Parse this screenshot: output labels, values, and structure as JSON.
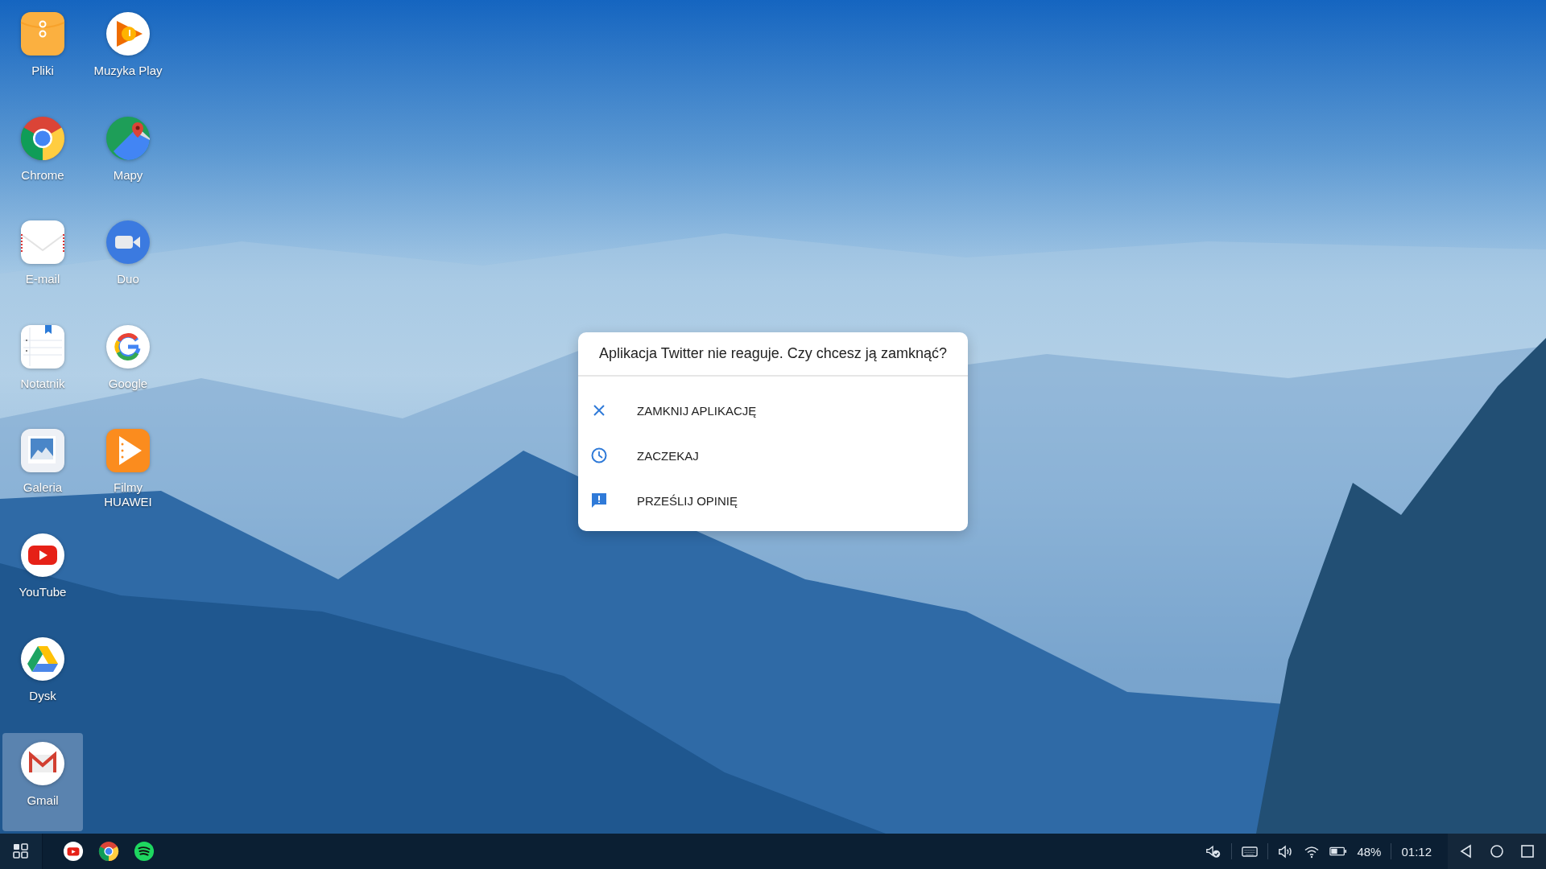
{
  "desktop_icons": [
    {
      "label": "Pliki",
      "kind": "files",
      "selected": false
    },
    {
      "label": "Chrome",
      "kind": "chrome",
      "selected": false
    },
    {
      "label": "E-mail",
      "kind": "email",
      "selected": false
    },
    {
      "label": "Notatnik",
      "kind": "notes",
      "selected": false
    },
    {
      "label": "Galeria",
      "kind": "gallery",
      "selected": false
    },
    {
      "label": "YouTube",
      "kind": "youtube",
      "selected": false
    },
    {
      "label": "Dysk",
      "kind": "drive",
      "selected": false
    },
    {
      "label": "Gmail",
      "kind": "gmail",
      "selected": true
    },
    {
      "label": "Muzyka Play",
      "kind": "music",
      "selected": false
    },
    {
      "label": "Mapy",
      "kind": "maps",
      "selected": false
    },
    {
      "label": "Duo",
      "kind": "duo",
      "selected": false
    },
    {
      "label": "Google",
      "kind": "google",
      "selected": false
    },
    {
      "label": "Filmy HUAWEI",
      "kind": "videos",
      "selected": false
    }
  ],
  "dialog": {
    "message": "Aplikacja Twitter nie reaguje. Czy chcesz ją zamknąć?",
    "actions": [
      {
        "label": "ZAMKNIJ APLIKACJĘ",
        "kind": "close"
      },
      {
        "label": "ZACZEKAJ",
        "kind": "wait"
      },
      {
        "label": "PRZEŚLIJ OPINIĘ",
        "kind": "feedback"
      }
    ]
  },
  "taskbar": {
    "battery_percent": "48%",
    "time": "01:12"
  }
}
